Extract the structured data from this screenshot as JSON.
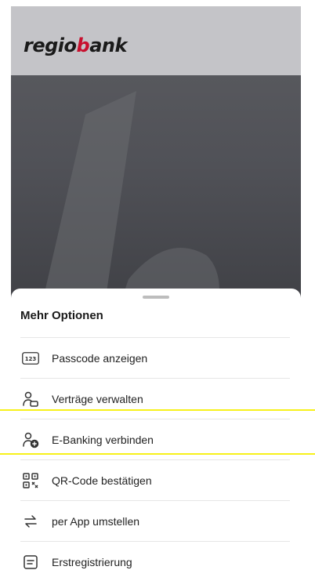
{
  "header": {
    "logo_part1": "regio",
    "logo_accent": "b",
    "logo_part2": "ank",
    "accent_color": "#c8102e"
  },
  "sheet": {
    "title": "Mehr Optionen",
    "items": [
      {
        "label": "Passcode anzeigen",
        "icon": "passcode-123-icon"
      },
      {
        "label": "Verträge verwalten",
        "icon": "users-contracts-icon"
      },
      {
        "label": "E-Banking verbinden",
        "icon": "user-add-icon",
        "highlighted": true
      },
      {
        "label": "QR-Code bestätigen",
        "icon": "qr-code-icon"
      },
      {
        "label": "per App umstellen",
        "icon": "switch-arrows-icon"
      },
      {
        "label": "Erstregistrierung",
        "icon": "form-document-icon"
      }
    ],
    "passcode_icon_text": "123"
  },
  "colors": {
    "highlight": "#f7f11a",
    "header_bg": "#c4c4c8",
    "hero_bg": "#505157"
  }
}
